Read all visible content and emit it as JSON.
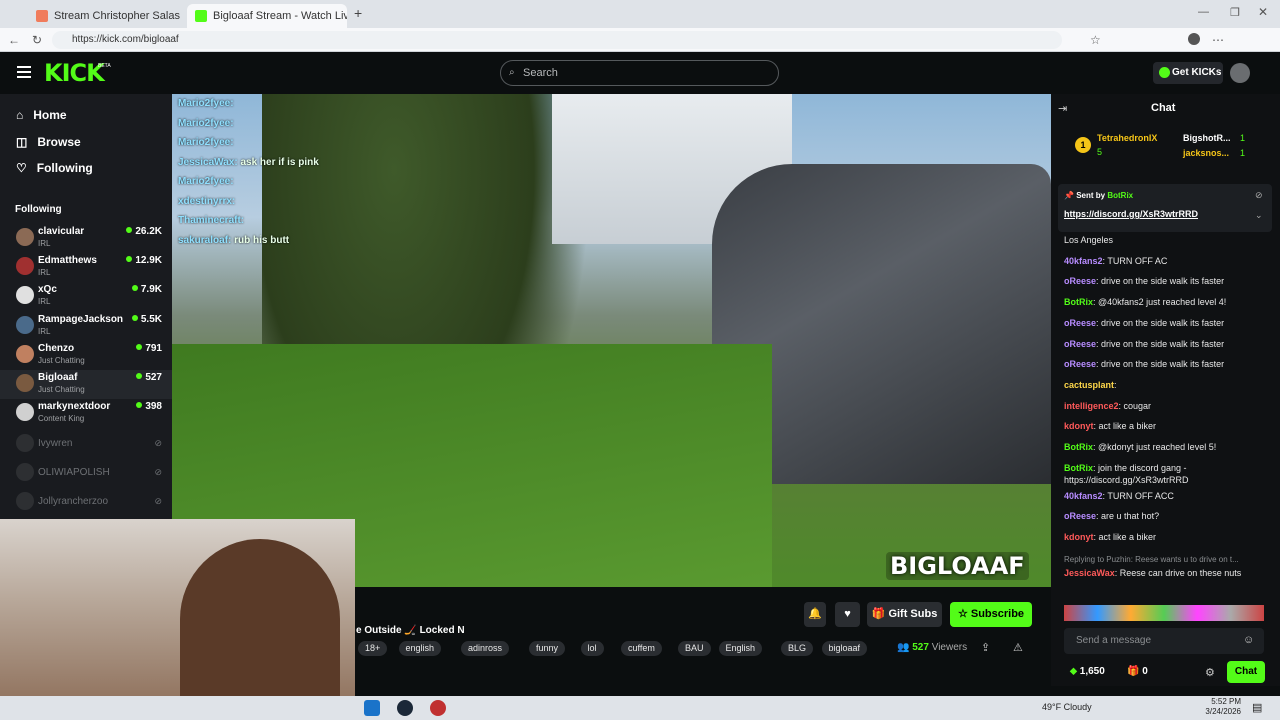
{
  "browser": {
    "tabs": [
      {
        "label": "Stream Christopher Salas | Listen t"
      },
      {
        "label": "Bigloaaf Stream - Watch Live"
      }
    ],
    "url": "https://kick.com/bigloaaf"
  },
  "header": {
    "logo": "KICK",
    "beta": "BETA",
    "search_placeholder": "Search",
    "get_kicks": "Get KICKs"
  },
  "sidebar": {
    "nav": [
      {
        "label": "Home",
        "icon": "home-icon"
      },
      {
        "label": "Browse",
        "icon": "browse-icon"
      },
      {
        "label": "Following",
        "icon": "heart-icon"
      }
    ],
    "following_title": "Following",
    "channels": [
      {
        "name": "clavicular",
        "category": "IRL",
        "viewers": "26.2K",
        "color": "#8b6a55"
      },
      {
        "name": "Edmatthews",
        "category": "IRL",
        "viewers": "12.9K",
        "color": "#a03030"
      },
      {
        "name": "xQc",
        "category": "IRL",
        "viewers": "7.9K",
        "color": "#e0e0e0"
      },
      {
        "name": "RampageJackson",
        "category": "IRL",
        "viewers": "5.5K",
        "color": "#4a6a8a"
      },
      {
        "name": "Chenzo",
        "category": "Just Chatting",
        "viewers": "791",
        "color": "#c08060"
      },
      {
        "name": "Bigloaaf",
        "category": "Just Chatting",
        "viewers": "527",
        "color": "#7a5a40"
      },
      {
        "name": "markynextdoor",
        "category": "Content King",
        "viewers": "398",
        "color": "#d0d0d0"
      }
    ],
    "offline": [
      "Ivywren",
      "OLIWIAPOLISH",
      "Jollyrancherzoo"
    ]
  },
  "video_chat": [
    {
      "user": "Mario2fyee:",
      "text": ""
    },
    {
      "user": "Mario2fyee:",
      "text": ""
    },
    {
      "user": "Mario2fyee:",
      "text": ""
    },
    {
      "user": "JessicaWax:",
      "text": "ask her if is pink"
    },
    {
      "user": "Mario2fyee:",
      "text": ""
    },
    {
      "user": "xdestinyrrx:",
      "text": ""
    },
    {
      "user": "Thaminecraft:",
      "text": ""
    },
    {
      "user": "sakuraloaf:",
      "text": "rub his butt"
    }
  ],
  "watermark": "BIGLOAAF",
  "stream": {
    "title": "e Outside 🏒 Locked N",
    "tags": [
      "18+",
      "english",
      "adinross",
      "funny",
      "lol",
      "cuffem",
      "BAU",
      "English",
      "BLG",
      "bigloaaf"
    ],
    "gift_subs": "Gift Subs",
    "subscribe": "Subscribe",
    "viewers": "527",
    "viewers_label": "Viewers"
  },
  "chat": {
    "title": "Chat",
    "leaderboard": [
      {
        "name": "TetrahedronIX",
        "count": "5"
      },
      {
        "name": "BigshotR...",
        "count": "1"
      },
      {
        "name": "jacksnos...",
        "count": "1"
      }
    ],
    "pinned": {
      "sent_by": "Sent by",
      "sender": "BotRix",
      "link": "https://discord.gg/XsR3wtrRRD"
    },
    "messages": [
      {
        "user": "",
        "text": "Los Angeles",
        "color": "#e8e8e8"
      },
      {
        "user": "40kfans2",
        "text": ": TURN OFF AC",
        "color": "#b78cff"
      },
      {
        "user": "oReese",
        "text": ": drive on the side walk its faster",
        "color": "#b78cff"
      },
      {
        "user": "BotRix",
        "text": ": @40kfans2 just reached level 4!",
        "color": "#53fc18"
      },
      {
        "user": "oReese",
        "text": ": drive on the side walk its faster",
        "color": "#b78cff"
      },
      {
        "user": "oReese",
        "text": ": drive on the side walk its faster",
        "color": "#b78cff"
      },
      {
        "user": "oReese",
        "text": ": drive on the side walk its faster",
        "color": "#b78cff"
      },
      {
        "user": "cactusplant",
        "text": ":",
        "color": "#ffd84a"
      },
      {
        "user": "intelligence2",
        "text": ": cougar",
        "color": "#ff5a5a"
      },
      {
        "user": "kdonyt",
        "text": ": act like a biker",
        "color": "#ff5a5a"
      },
      {
        "user": "BotRix",
        "text": ": @kdonyt just reached level 5!",
        "color": "#53fc18"
      },
      {
        "user": "BotRix",
        "text": ": join the discord gang - https://discord.gg/XsR3wtrRRD",
        "color": "#53fc18"
      },
      {
        "user": "40kfans2",
        "text": ": TURN OFF ACC",
        "color": "#b78cff"
      },
      {
        "user": "oReese",
        "text": ": are u that hot?",
        "color": "#b78cff"
      },
      {
        "user": "kdonyt",
        "text": ": act like a biker",
        "color": "#ff5a5a"
      }
    ],
    "reply_note": "Replying to Puzhin: Reese wants u to drive on t...",
    "reply_user": "JessicaWax",
    "reply_text": ": Reese can drive on these nuts",
    "placeholder": "Send a message",
    "points": "1,650",
    "other_count": "0",
    "chat_button": "Chat"
  },
  "taskbar": {
    "weather": "49°F  Cloudy",
    "time": "5:52 PM",
    "date": "3/24/2026"
  },
  "colors": {
    "accent": "#53fc18",
    "bg": "#0b0e0f"
  }
}
